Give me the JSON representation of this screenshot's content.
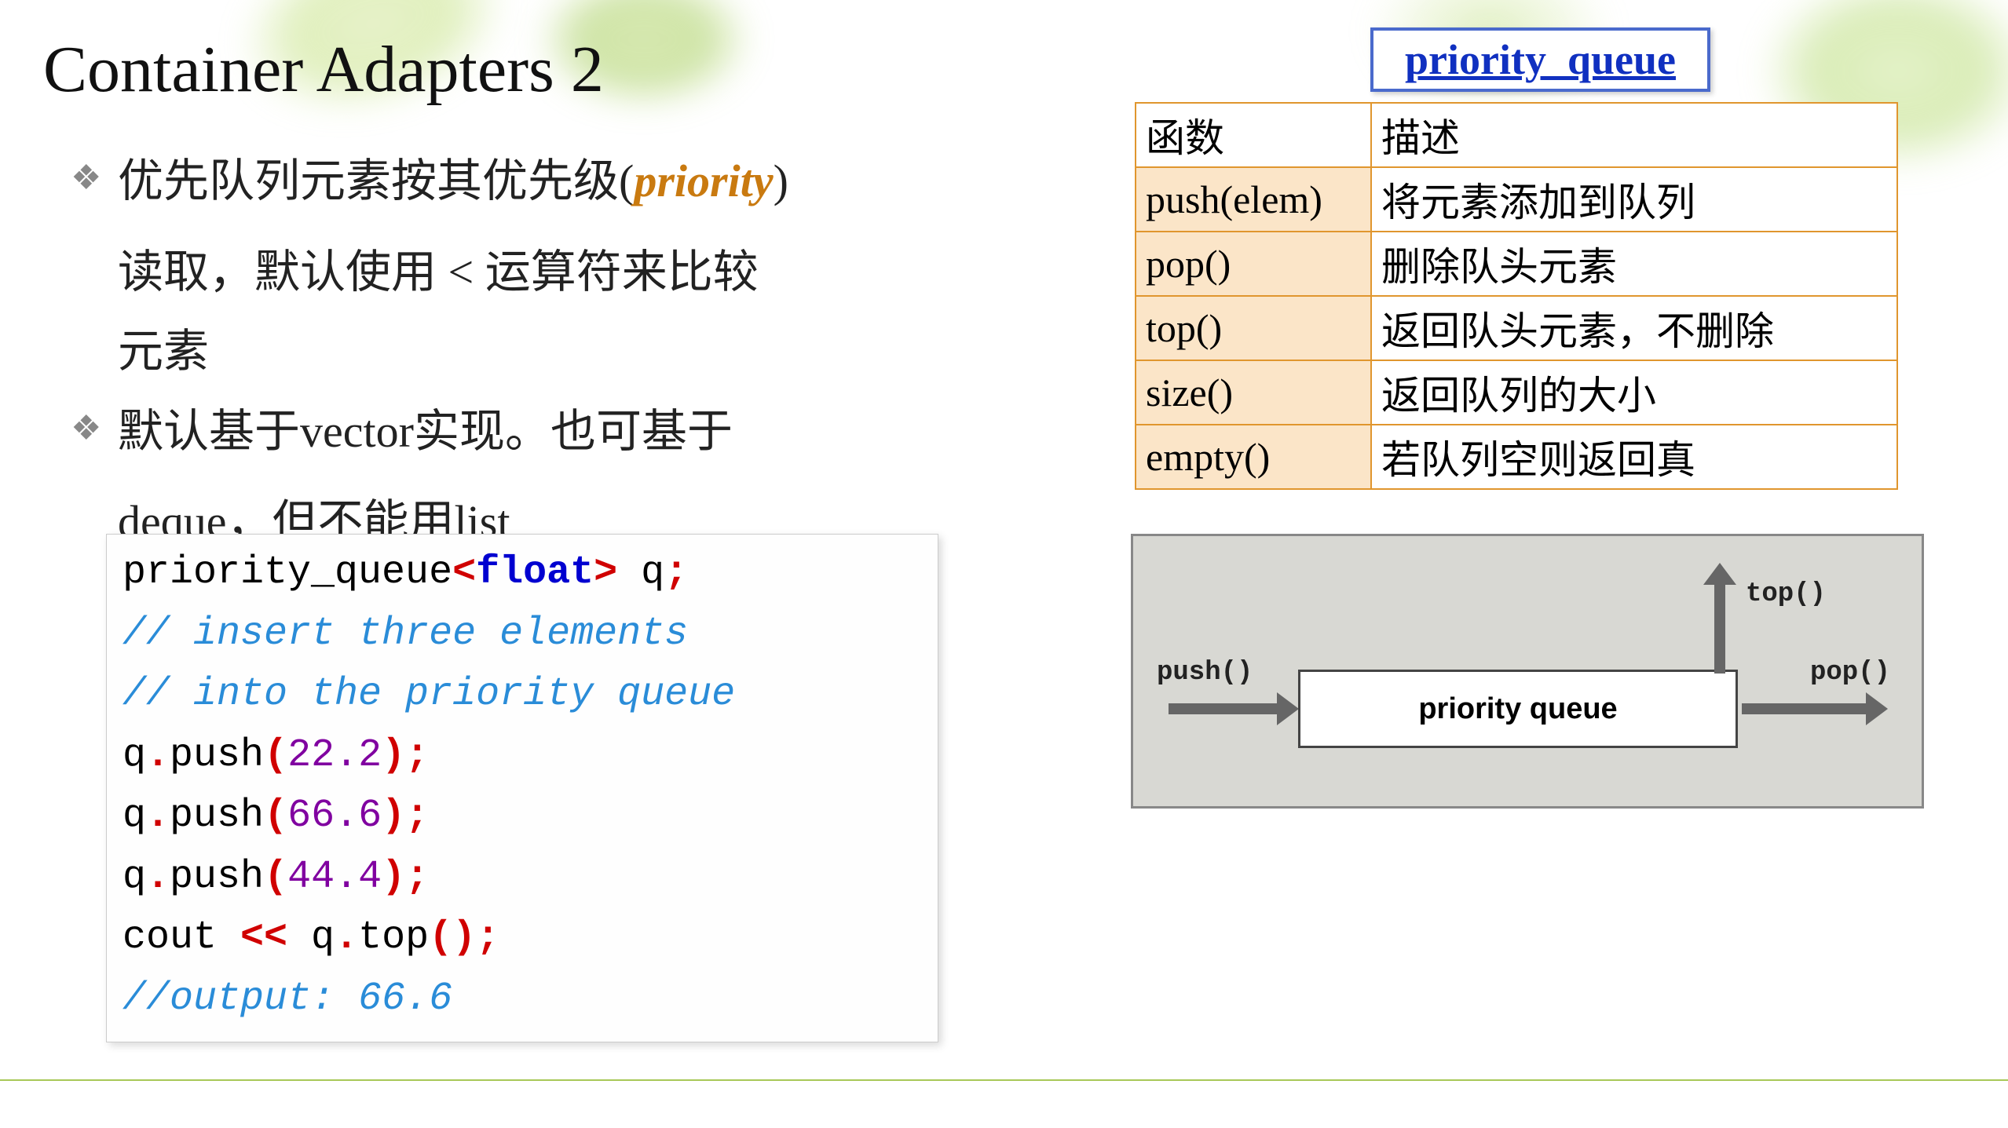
{
  "title": "Container Adapters 2",
  "bullets": {
    "b1_pre": "优先队列元素按其优先级(",
    "b1_priority": "priority",
    "b1_post": ")",
    "b1_line2": "读取，默认使用 < 运算符来比较",
    "b1_line3": "元素",
    "b2_pre": "默认基于",
    "b2_vector": "vector",
    "b2_mid": "实现。也可基于",
    "b2_line2_pre": "deque",
    "b2_line2_mid": "，但不能用",
    "b2_line2_list": "list"
  },
  "code": {
    "l1_a": "priority_queue",
    "l1_b": "<",
    "l1_c": "float",
    "l1_d": ">",
    "l1_e": " q",
    "l1_f": ";",
    "l2": "// insert three elements",
    "l3": "// into the priority queue",
    "l4_a": "q",
    "l4_b": ".",
    "l4_c": "push",
    "l4_d": "(",
    "l4_e": "22.2",
    "l4_f": ");",
    "l5_e": "66.6",
    "l6_e": "44.4",
    "l7_a": "cout ",
    "l7_b": "<<",
    "l7_c": " q",
    "l7_d": ".",
    "l7_e": "top",
    "l7_f": "();",
    "l8": "//output: 66.6"
  },
  "tableTitle": "priority_queue",
  "table": {
    "h1": "函数",
    "h2": "描述",
    "rows": [
      {
        "fn": "push(elem)",
        "desc": "将元素添加到队列"
      },
      {
        "fn": "pop()",
        "desc": "删除队头元素"
      },
      {
        "fn": "top()",
        "desc": "返回队头元素，不删除"
      },
      {
        "fn": "size()",
        "desc": "返回队列的大小"
      },
      {
        "fn": "empty()",
        "desc": "若队列空则返回真"
      }
    ]
  },
  "diagram": {
    "box": "priority queue",
    "push": "push()",
    "pop": "pop()",
    "top": "top()"
  }
}
